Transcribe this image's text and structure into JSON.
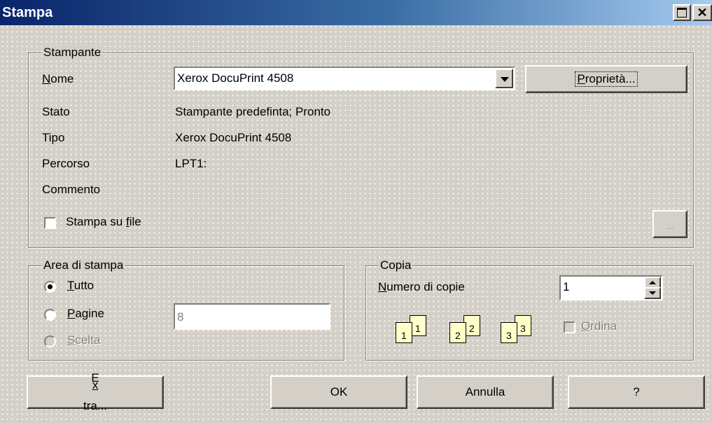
{
  "window": {
    "title": "Stampa"
  },
  "printer": {
    "legend": "Stampante",
    "name_label": "Nome",
    "name_value": "Xerox DocuPrint 4508",
    "properties_button": "Proprietà...",
    "status_label": "Stato",
    "status_value": "Stampante predefinta; Pronto",
    "type_label": "Tipo",
    "type_value": "Xerox DocuPrint 4508",
    "path_label": "Percorso",
    "path_value": "LPT1:",
    "comment_label": "Commento",
    "print_to_file_label": "Stampa su file",
    "print_to_file_checked": false,
    "browse_button": "..."
  },
  "print_range": {
    "legend": "Area di stampa",
    "all_label": "Tutto",
    "pages_label": "Pagine",
    "pages_value": "8",
    "selection_label": "Scelta",
    "selected": "all"
  },
  "copies": {
    "legend": "Copia",
    "count_label": "Numero di copie",
    "count_value": "1",
    "collate_label": "Ordina",
    "collate_checked": false,
    "page_labels": [
      "1",
      "1",
      "2",
      "2",
      "3",
      "3"
    ]
  },
  "buttons": {
    "extra": "Extra...",
    "ok": "OK",
    "cancel": "Annulla",
    "help": "?"
  }
}
